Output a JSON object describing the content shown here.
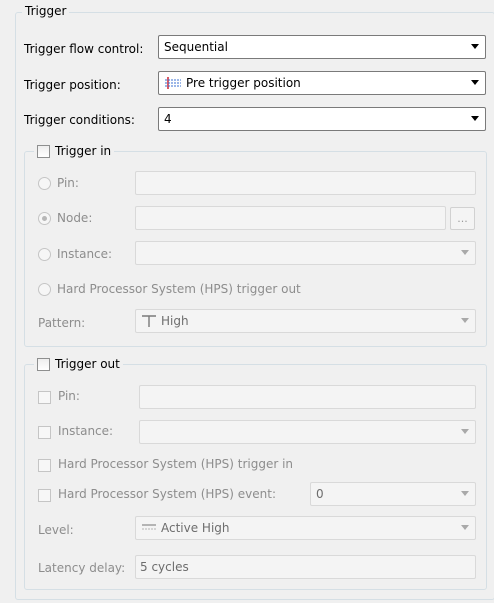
{
  "trigger_group": {
    "title": "Trigger"
  },
  "flow_control": {
    "label": "Trigger flow control:",
    "value": "Sequential"
  },
  "position": {
    "label": "Trigger position:",
    "value": "Pre trigger position"
  },
  "conditions": {
    "label": "Trigger conditions:",
    "value": "4"
  },
  "trigger_in": {
    "title": "Trigger in",
    "pin_label": "Pin:",
    "node_label": "Node:",
    "browse_label": "...",
    "instance_label": "Instance:",
    "hps_label": "Hard Processor System (HPS) trigger out",
    "pattern_label": "Pattern:",
    "pattern_value": "High"
  },
  "trigger_out": {
    "title": "Trigger out",
    "pin_label": "Pin:",
    "instance_label": "Instance:",
    "hps_trigger_in_label": "Hard Processor System (HPS) trigger in",
    "hps_event_label": "Hard Processor System (HPS) event:",
    "hps_event_value": "0",
    "level_label": "Level:",
    "level_value": "Active High",
    "latency_label": "Latency delay:",
    "latency_value": "5 cycles"
  }
}
